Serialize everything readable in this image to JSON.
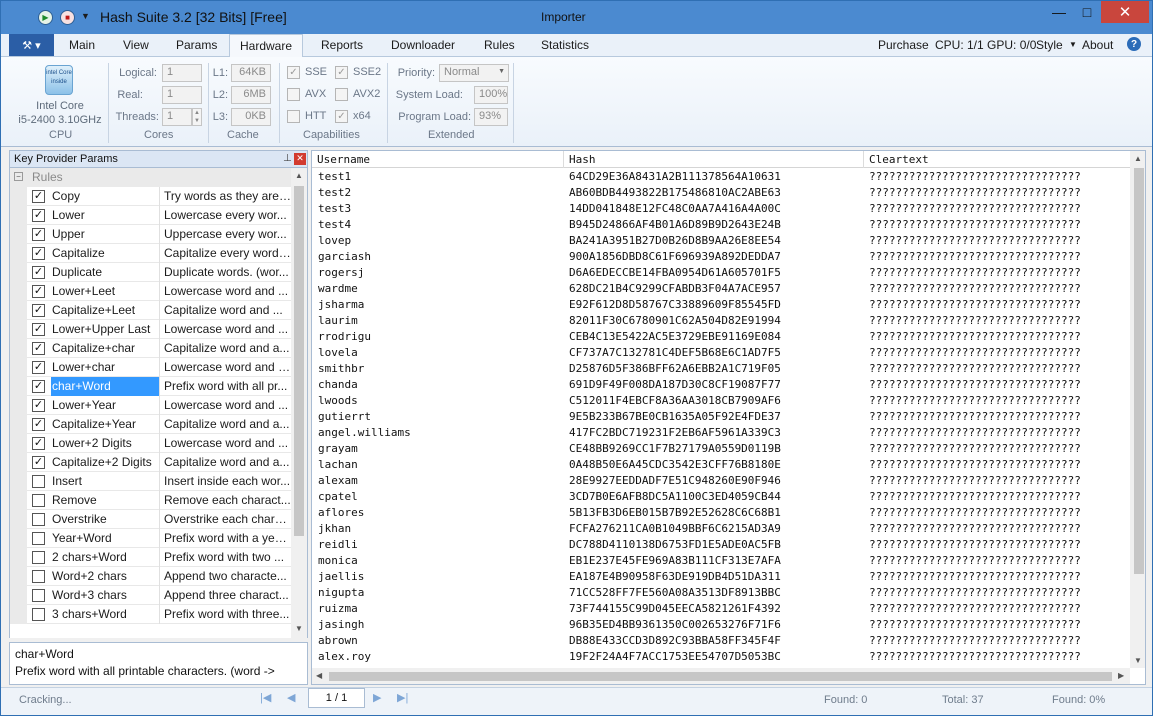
{
  "app": {
    "title": "Hash Suite 3.2 [32 Bits] [Free]",
    "window_center": "Importer",
    "app_menu_icon": "tools-icon"
  },
  "tabs": [
    "Main",
    "View",
    "Params",
    "Hardware",
    "Reports",
    "Downloader",
    "Rules",
    "Statistics"
  ],
  "active_tab": "Hardware",
  "right_info": {
    "purchase": "Purchase",
    "cpu_gpu": "CPU: 1/1 GPU: 0/0",
    "style": "Style",
    "about": "About"
  },
  "ribbon": {
    "cpu": {
      "chip_text": "intel Core inside",
      "name_line1": "Intel Core",
      "name_line2": "i5-2400 3.10GHz",
      "group": "CPU"
    },
    "cores": {
      "logical_label": "Logical:",
      "logical_value": "1",
      "real_label": "Real:",
      "real_value": "1",
      "threads_label": "Threads:",
      "threads_value": "1",
      "group": "Cores"
    },
    "cache": {
      "l1_label": "L1:",
      "l1_value": "64KB",
      "l2_label": "L2:",
      "l2_value": "6MB",
      "l3_label": "L3:",
      "l3_value": "0KB",
      "group": "Cache"
    },
    "capabilities": {
      "sse": "SSE",
      "sse2": "SSE2",
      "avx": "AVX",
      "avx2": "AVX2",
      "htt": "HTT",
      "x64": "x64",
      "group": "Capabilities"
    },
    "extended": {
      "priority_label": "Priority:",
      "priority_value": "Normal",
      "system_load_label": "System Load:",
      "system_load_value": "100%",
      "program_load_label": "Program Load:",
      "program_load_value": "93%",
      "group": "Extended"
    }
  },
  "left_panel": {
    "title": "Key Provider Params",
    "group_header": "Rules",
    "rules": [
      {
        "name": "Copy",
        "desc": "Try words as they are....",
        "checked": true
      },
      {
        "name": "Lower",
        "desc": "Lowercase every wor...",
        "checked": true
      },
      {
        "name": "Upper",
        "desc": "Uppercase every wor...",
        "checked": true
      },
      {
        "name": "Capitalize",
        "desc": "Capitalize every word....",
        "checked": true
      },
      {
        "name": "Duplicate",
        "desc": "Duplicate words. (wor...",
        "checked": true
      },
      {
        "name": "Lower+Leet",
        "desc": "Lowercase word and ...",
        "checked": true
      },
      {
        "name": "Capitalize+Leet",
        "desc": "Capitalize word and ...",
        "checked": true
      },
      {
        "name": "Lower+Upper Last",
        "desc": "Lowercase word and ...",
        "checked": true
      },
      {
        "name": "Capitalize+char",
        "desc": "Capitalize word and a...",
        "checked": true
      },
      {
        "name": "Lower+char",
        "desc": "Lowercase word and a...",
        "checked": true
      },
      {
        "name": "char+Word",
        "desc": "Prefix word with all pr...",
        "checked": true,
        "selected": true
      },
      {
        "name": "Lower+Year",
        "desc": "Lowercase word and ...",
        "checked": true
      },
      {
        "name": "Capitalize+Year",
        "desc": "Capitalize word and a...",
        "checked": true
      },
      {
        "name": "Lower+2 Digits",
        "desc": "Lowercase word and ...",
        "checked": true
      },
      {
        "name": "Capitalize+2 Digits",
        "desc": "Capitalize word and a...",
        "checked": true
      },
      {
        "name": "Insert",
        "desc": "Insert inside each wor...",
        "checked": false
      },
      {
        "name": "Remove",
        "desc": "Remove each charact...",
        "checked": false
      },
      {
        "name": "Overstrike",
        "desc": "Overstrike each chara...",
        "checked": false
      },
      {
        "name": "Year+Word",
        "desc": "Prefix word with a yea...",
        "checked": false
      },
      {
        "name": "2 chars+Word",
        "desc": "Prefix word with two ...",
        "checked": false
      },
      {
        "name": "Word+2 chars",
        "desc": "Append two characte...",
        "checked": false
      },
      {
        "name": "Word+3 chars",
        "desc": "Append three charact...",
        "checked": false
      },
      {
        "name": "3 chars+Word",
        "desc": "Prefix word with three...",
        "checked": false
      }
    ],
    "desc_title": "char+Word",
    "desc_text": "Prefix word with all printable characters. (word ->"
  },
  "table": {
    "columns": [
      "Username",
      "Hash",
      "Cleartext"
    ],
    "rows": [
      [
        "test1",
        "64CD29E36A8431A2B111378564A10631",
        "????????????????????????????????"
      ],
      [
        "test2",
        "AB60BDB4493822B175486810AC2ABE63",
        "????????????????????????????????"
      ],
      [
        "test3",
        "14DD041848E12FC48C0AA7A416A4A00C",
        "????????????????????????????????"
      ],
      [
        "test4",
        "B945D24866AF4B01A6D89B9D2643E24B",
        "????????????????????????????????"
      ],
      [
        "lovep",
        "BA241A3951B27D0B26D8B9AA26E8EE54",
        "????????????????????????????????"
      ],
      [
        "garciash",
        "900A1856DBD8C61F696939A892DEDDA7",
        "????????????????????????????????"
      ],
      [
        "rogersj",
        "D6A6EDECCBE14FBA0954D61A605701F5",
        "????????????????????????????????"
      ],
      [
        "wardme",
        "628DC21B4C9299CFABDB3F04A7ACE957",
        "????????????????????????????????"
      ],
      [
        "jsharma",
        "E92F612D8D58767C33889609F85545FD",
        "????????????????????????????????"
      ],
      [
        "laurim",
        "82011F30C6780901C62A504D82E91994",
        "????????????????????????????????"
      ],
      [
        "rrodrigu",
        "CEB4C13E5422AC5E3729EBE91169E084",
        "????????????????????????????????"
      ],
      [
        "lovela",
        "CF737A7C132781C4DEF5B68E6C1AD7F5",
        "????????????????????????????????"
      ],
      [
        "smithbr",
        "D25876D5F386BFF62A6EBB2A1C719F05",
        "????????????????????????????????"
      ],
      [
        "chanda",
        "691D9F49F008DA187D30C8CF19087F77",
        "????????????????????????????????"
      ],
      [
        "lwoods",
        "C512011F4EBCF8A36AA3018CB7909AF6",
        "????????????????????????????????"
      ],
      [
        "gutierrt",
        "9E5B233B67BE0CB1635A05F92E4FDE37",
        "????????????????????????????????"
      ],
      [
        "angel.williams",
        "417FC2BDC719231F2EB6AF5961A339C3",
        "????????????????????????????????"
      ],
      [
        "grayam",
        "CE48BB9269CC1F7B27179A0559D0119B",
        "????????????????????????????????"
      ],
      [
        "lachan",
        "0A48B50E6A45CDC3542E3CFF76B8180E",
        "????????????????????????????????"
      ],
      [
        "alexam",
        "28E9927EEDDADF7E51C948260E90F946",
        "????????????????????????????????"
      ],
      [
        "cpatel",
        "3CD7B0E6AFB8DC5A1100C3ED4059CB44",
        "????????????????????????????????"
      ],
      [
        "aflores",
        "5B13FB3D6EB015B7B92E52628C6C68B1",
        "????????????????????????????????"
      ],
      [
        "jkhan",
        "FCFA276211CA0B1049BBF6C6215AD3A9",
        "????????????????????????????????"
      ],
      [
        "reidli",
        "DC788D4110138D6753FD1E5ADE0AC5FB",
        "????????????????????????????????"
      ],
      [
        "monica",
        "EB1E237E45FE969A83B111CF313E7AFA",
        "????????????????????????????????"
      ],
      [
        "jaellis",
        "EA187E4B90958F63DE919DB4D51DA311",
        "????????????????????????????????"
      ],
      [
        "nigupta",
        "71CC528FF7FE560A08A3513DF8913BBC",
        "????????????????????????????????"
      ],
      [
        "ruizma",
        "73F744155C99D045EECA5821261F4392",
        "????????????????????????????????"
      ],
      [
        "jasingh",
        "96B35ED4BB9361350C002653276F71F6",
        "????????????????????????????????"
      ],
      [
        "abrown",
        "DB88E433CCD3D892C93BBA58FF345F4F",
        "????????????????????????????????"
      ],
      [
        "alex.roy",
        "19F2F24A4F7ACC1753EE54707D5053BC",
        "????????????????????????????????"
      ]
    ]
  },
  "status": {
    "state": "Cracking...",
    "page": "1 / 1",
    "found": "Found: 0",
    "total": "Total: 37",
    "found_pct": "Found: 0%"
  }
}
